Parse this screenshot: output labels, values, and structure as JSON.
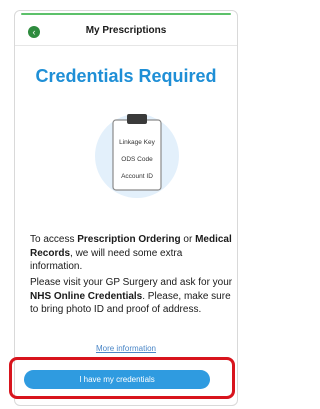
{
  "header": {
    "title": "My Prescriptions",
    "back_icon": "back-arrow-icon"
  },
  "heading": "Credentials Required",
  "illustration": {
    "items": [
      "Linkage Key",
      "ODS Code",
      "Account ID"
    ],
    "icon": "clipboard-icon"
  },
  "paragraph1": {
    "prefix": "To access ",
    "bold1": "Prescription Ordering",
    "middle": " or ",
    "bold2": "Medical Records",
    "suffix": ", we will need some extra information."
  },
  "paragraph2": {
    "prefix": "Please visit your GP Surgery and ask for your ",
    "bold": "NHS Online Credentials",
    "suffix": ". Please, make sure to bring photo ID and proof of address."
  },
  "more_link": "More information",
  "button_label": "I have my credentials",
  "colors": {
    "accent": "#1f8fd6",
    "button": "#2f9be0",
    "highlight": "#d8141d",
    "topline": "#5cc16a"
  }
}
